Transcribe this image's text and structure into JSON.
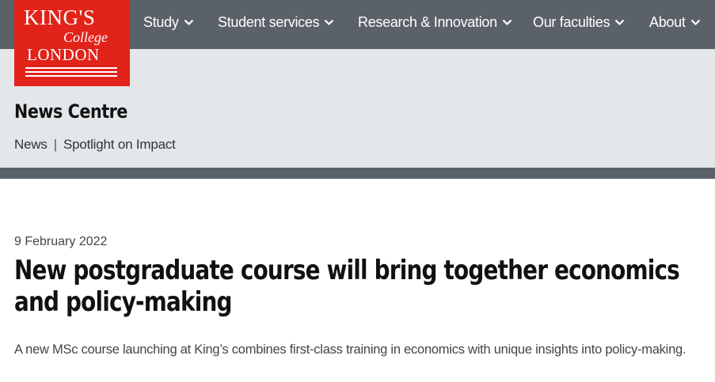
{
  "logo": {
    "line1": "KING'S",
    "line2": "College",
    "line3": "LONDON"
  },
  "nav": {
    "items": [
      {
        "label": "Study"
      },
      {
        "label": "Student services"
      },
      {
        "label": "Research & Innovation"
      },
      {
        "label": "Our faculties"
      },
      {
        "label": "About"
      }
    ]
  },
  "section": {
    "title": "News Centre"
  },
  "breadcrumb": {
    "items": [
      "News",
      "Spotlight on Impact"
    ],
    "separator": "|"
  },
  "article": {
    "date": "9 February 2022",
    "headline": "New postgraduate course will bring together economics and policy-making",
    "summary": "A new MSc course launching at King’s combines first-class training in economics with unique insights into policy-making."
  },
  "colors": {
    "brand_red": "#e2231a",
    "nav_bar": "#5b6168",
    "subheader_bg": "#e3e7ea"
  },
  "icons": {
    "nav_dropdown": "chevron-down-icon"
  }
}
